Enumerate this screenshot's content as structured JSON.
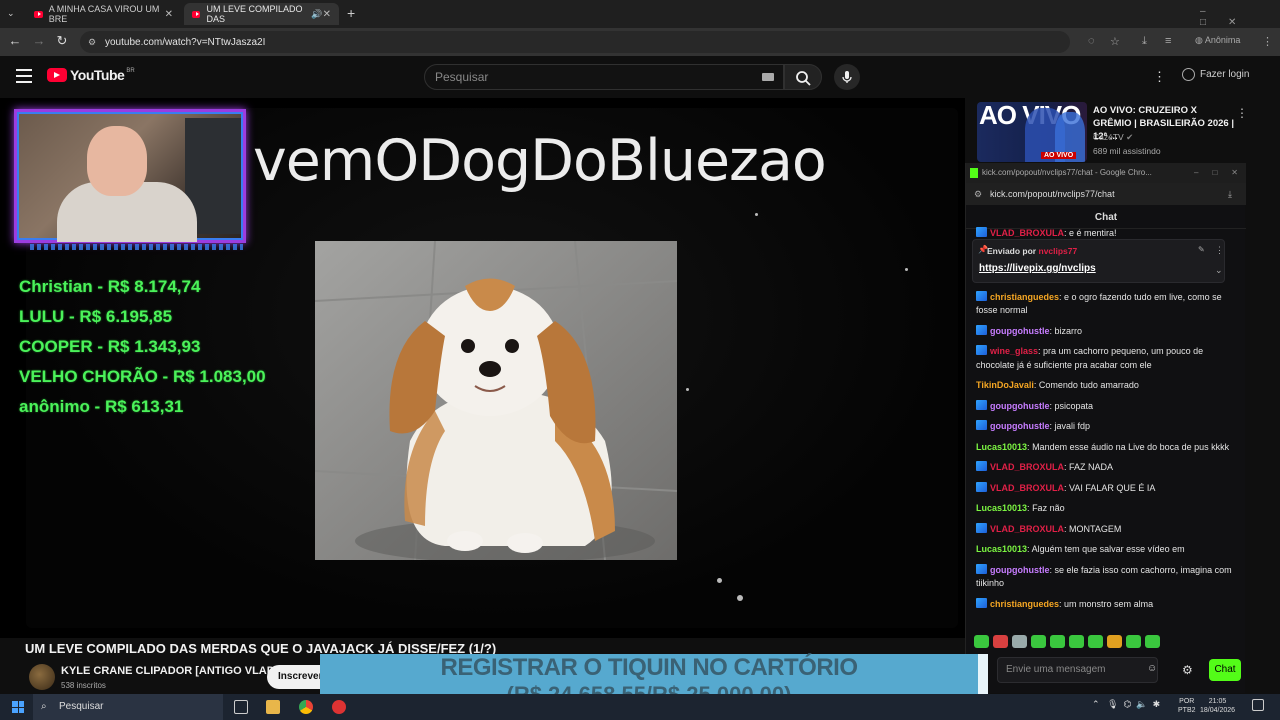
{
  "browser": {
    "tabs": [
      {
        "title": "A MINHA CASA VIROU UM BRE"
      },
      {
        "title": "UM LEVE COMPILADO DAS",
        "active": true
      }
    ],
    "url": "youtube.com/watch?v=NTtwJasza2I",
    "profile_label": "Anônima"
  },
  "youtube": {
    "logo_text": "YouTube",
    "region": "BR",
    "search_placeholder": "Pesquisar",
    "login_label": "Fazer login"
  },
  "stream": {
    "title_text": "vemODogDoBluezao",
    "donations": [
      "Christian - R$ 8.174,74",
      "LULU - R$ 6.195,85",
      "COOPER - R$ 1.343,93",
      "VELHO CHORÃO - R$ 1.083,00",
      "anônimo - R$ 613,31"
    ],
    "goal_line1": "REGISTRAR O TIQUIN NO CARTÓRIO",
    "goal_line2": "(R$ 24.658,55/R$ 25.000,00)"
  },
  "video": {
    "title": "UM LEVE COMPILADO DAS MERDAS QUE O JAVAJACK JÁ DISSE/FEZ (1/?)",
    "channel": "KYLE CRANE CLIPADOR [ANTIGO VLAD]",
    "subscribers": "538 inscritos",
    "subscribe_label": "Inscrever-se"
  },
  "recommendation": {
    "thumb_text": "AO VIVO",
    "badge": "AO VIVO",
    "title": "AO VIVO: CRUZEIRO X GRÊMIO | BRASILEIRÃO 2026 | 12ª ...",
    "channel": "CazéTV",
    "viewers": "689 mil assistindo"
  },
  "kick": {
    "window_title": "kick.com/popout/nvclips77/chat - Google Chro...",
    "url": "kick.com/popout/nvclips77/chat",
    "header": "Chat",
    "pinned_by": "Enviado por",
    "pinned_user": "nvclips77",
    "pinned_link": "https://livepix.gg/nvclips",
    "messages": [
      {
        "user": "VLAD_BROXULA",
        "text": "e é mentira!",
        "color": "#e02047",
        "badge": true
      },
      {
        "user": "christianguedes",
        "text": "e o ogro fazendo tudo em live, como se fosse normal",
        "color": "#f5a623",
        "badge": true
      },
      {
        "user": "goupgohustle",
        "text": "bizarro",
        "color": "#c77dff",
        "badge": true
      },
      {
        "user": "wine_glass",
        "text": "pra um cachorro pequeno, um pouco de chocolate já é suficiente pra acabar com ele",
        "color": "#e02047",
        "badge": true
      },
      {
        "user": "TikinDoJavali",
        "text": "Comendo tudo amarrado",
        "color": "#f5a623",
        "badge": false
      },
      {
        "user": "goupgohustle",
        "text": "psicopata",
        "color": "#c77dff",
        "badge": true
      },
      {
        "user": "goupgohustle",
        "text": "javali fdp",
        "color": "#c77dff",
        "badge": true
      },
      {
        "user": "Lucas10013",
        "text": "Mandem esse áudio na Live do boca de pus kkkk",
        "color": "#7cf542",
        "badge": false
      },
      {
        "user": "VLAD_BROXULA",
        "text": "FAZ NADA",
        "color": "#e02047",
        "badge": true
      },
      {
        "user": "VLAD_BROXULA",
        "text": "VAI FALAR QUE É IA",
        "color": "#e02047",
        "badge": true
      },
      {
        "user": "Lucas10013",
        "text": "Faz não",
        "color": "#7cf542",
        "badge": false
      },
      {
        "user": "VLAD_BROXULA",
        "text": "MONTAGEM",
        "color": "#e02047",
        "badge": true
      },
      {
        "user": "Lucas10013",
        "text": "Alguém tem que salvar esse vídeo em",
        "color": "#7cf542",
        "badge": false
      },
      {
        "user": "goupgohustle",
        "text": "se ele fazia isso com cachorro, imagina com tiikinho",
        "color": "#c77dff",
        "badge": true
      },
      {
        "user": "christianguedes",
        "text": "um monstro sem alma",
        "color": "#f5a623",
        "badge": true
      }
    ],
    "input_placeholder": "Envie uma mensagem",
    "send_label": "Chat"
  },
  "taskbar": {
    "search_label": "Pesquisar",
    "lang1": "POR",
    "lang2": "PTB2",
    "time": "21:05",
    "date": "18/04/2026"
  }
}
